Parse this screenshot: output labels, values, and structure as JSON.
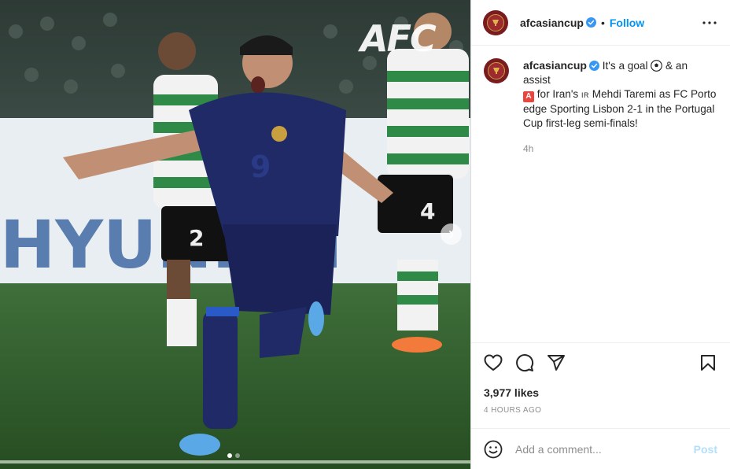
{
  "media": {
    "watermark": "AFC",
    "slide_count": 2,
    "active_slide": 1,
    "next_icon": "chevron-right-icon"
  },
  "header": {
    "username": "afcasiancup",
    "separator": "•",
    "follow_label": "Follow",
    "more_icon": "more-horizontal-icon"
  },
  "caption": {
    "username": "afcasiancup",
    "text_1": "It's a goal ",
    "text_2": " & an assist ",
    "text_3": " for Iran's ",
    "flag_text": "IR",
    "text_4": " Mehdi Taremi as FC Porto edge Sporting Lisbon 2-1 in the Portugal Cup first-leg semi-finals!",
    "assist_badge": "A",
    "relative_time": "4h"
  },
  "actions": {
    "like_icon": "heart-icon",
    "comment_icon": "comment-icon",
    "share_icon": "share-icon",
    "save_icon": "bookmark-icon"
  },
  "likes": "3,977 likes",
  "timestamp": "4 HOURS AGO",
  "comment": {
    "placeholder": "Add a comment...",
    "post_label": "Post"
  },
  "colors": {
    "accent": "#0095f6",
    "post_disabled": "#b2dffc",
    "avatar": "#7a1b20",
    "verified": "#3897f0"
  }
}
